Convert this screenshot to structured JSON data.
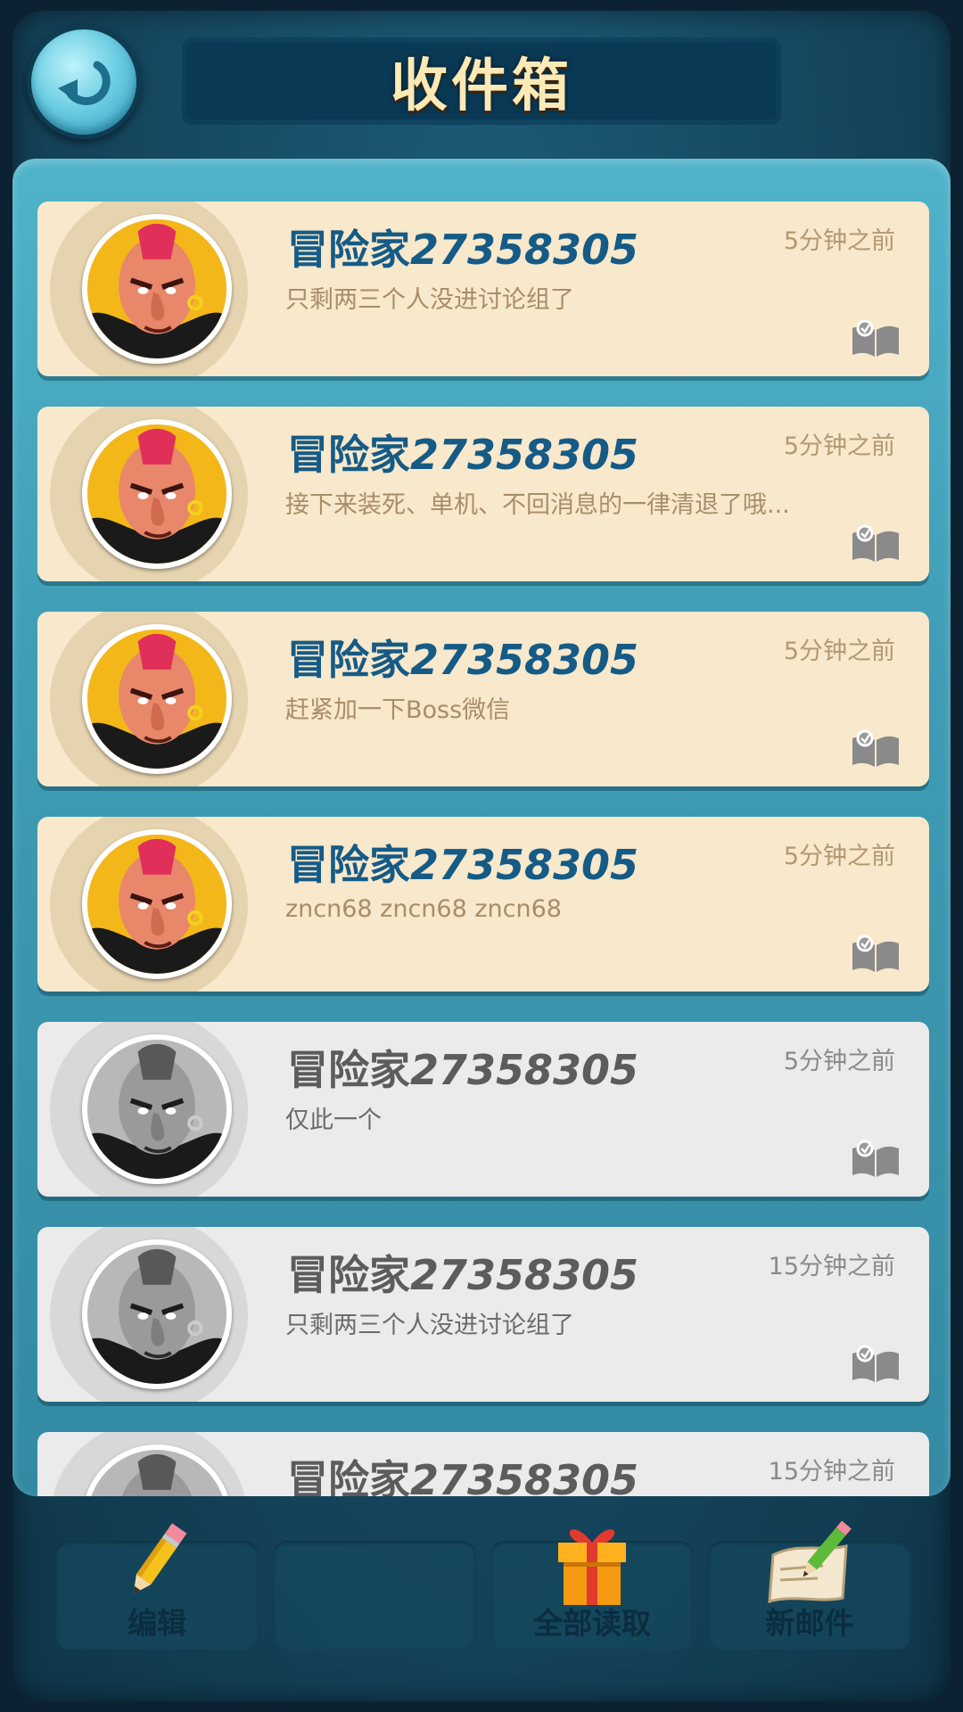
{
  "header": {
    "title": "收件箱"
  },
  "messages": [
    {
      "sender_prefix": "冒险家",
      "sender_id": "27358305",
      "time": "5分钟之前",
      "preview": "只剩两三个人没进讨论组了",
      "read": false
    },
    {
      "sender_prefix": "冒险家",
      "sender_id": "27358305",
      "time": "5分钟之前",
      "preview": "接下来装死、单机、不回消息的一律清退了哦...",
      "read": false
    },
    {
      "sender_prefix": "冒险家",
      "sender_id": "27358305",
      "time": "5分钟之前",
      "preview": "赶紧加一下Boss微信",
      "read": false
    },
    {
      "sender_prefix": "冒险家",
      "sender_id": "27358305",
      "time": "5分钟之前",
      "preview": "zncn68   zncn68   zncn68",
      "read": false
    },
    {
      "sender_prefix": "冒险家",
      "sender_id": "27358305",
      "time": "5分钟之前",
      "preview": "仅此一个",
      "read": true
    },
    {
      "sender_prefix": "冒险家",
      "sender_id": "27358305",
      "time": "15分钟之前",
      "preview": "只剩两三个人没进讨论组了",
      "read": true
    },
    {
      "sender_prefix": "冒险家",
      "sender_id": "27358305",
      "time": "15分钟之前",
      "preview": "",
      "read": true
    }
  ],
  "toolbar": {
    "edit_label": "编辑",
    "read_all_label": "全部读取",
    "new_mail_label": "新邮件"
  },
  "icons": {
    "back": "back-arrow-icon",
    "message": "open-book-icon",
    "edit": "pencil-icon",
    "read_all": "gift-box-icon",
    "new_mail": "scroll-quill-icon"
  }
}
